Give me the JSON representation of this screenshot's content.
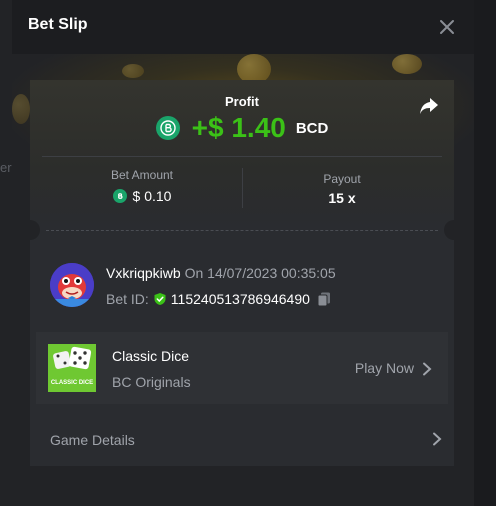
{
  "backdrop": {
    "left_fragment": "er"
  },
  "modal": {
    "title": "Bet Slip"
  },
  "profit": {
    "label": "Profit",
    "amount": "+$ 1.40",
    "currency": "BCD"
  },
  "bet_amount": {
    "label": "Bet Amount",
    "value": "$ 0.10"
  },
  "payout": {
    "label": "Payout",
    "value": "15 x"
  },
  "bet": {
    "username": "Vxkriqpkiwb",
    "date_text": "On 14/07/2023 00:35:05",
    "id_label": "Bet ID:",
    "id_value": "115240513786946490"
  },
  "game": {
    "name": "Classic Dice",
    "provider": "BC Originals",
    "thumb_text": "CLASSIC DICE",
    "play_label": "Play Now"
  },
  "details": {
    "label": "Game Details"
  },
  "colors": {
    "profit_green": "#3bc117",
    "bc_coin": "#1aa46a",
    "background": "#222326"
  },
  "icons": [
    "close-icon",
    "share-icon",
    "bc-coin-icon",
    "shield-check-icon",
    "copy-icon",
    "chevron-right-icon",
    "avatar-dino"
  ]
}
